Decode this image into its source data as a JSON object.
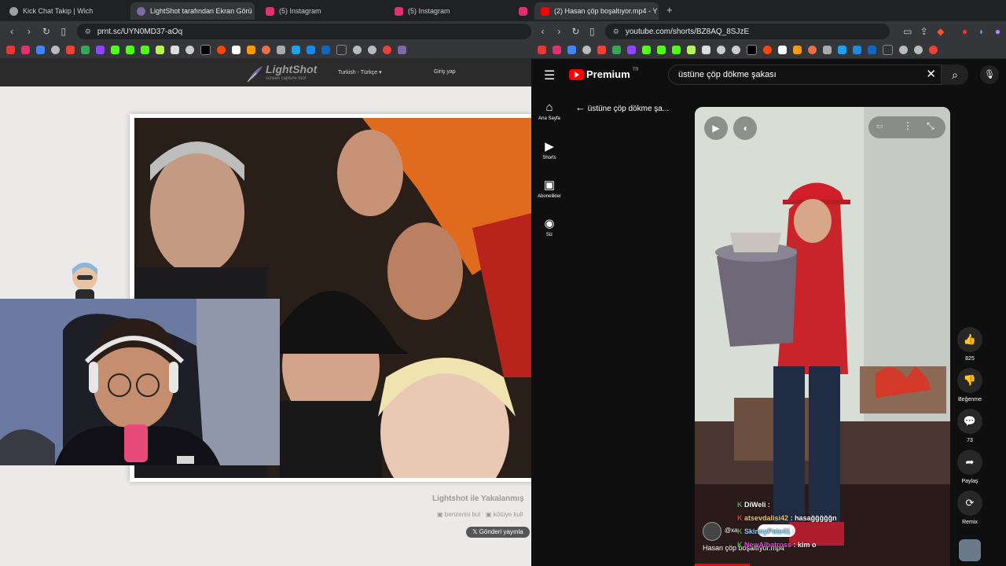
{
  "left_window": {
    "tabs": [
      {
        "title": "Kick Chat Takip | Wich",
        "color": "#9aa0a6"
      },
      {
        "title": "LightShot tarafından Ekran Görü",
        "color": "#7f6aa8"
      },
      {
        "title": "(5) Instagram",
        "color": "#e1306c"
      },
      {
        "title": "(5) Instagram",
        "color": "#e1306c"
      }
    ],
    "tab_close": "✕",
    "url": "prnt.sc/UYN0MD37-aOq"
  },
  "lightshot": {
    "logo": "LightShot",
    "tagline": "screen capture tool",
    "language": "Turkish - Türkçe",
    "login": "Giriş yap",
    "caption": "Lightshot ile Yakalanmış",
    "link_similar": "benzerini bul",
    "link_report": "kötüye kull",
    "tweet": "Gönderi yayınla"
  },
  "right_window": {
    "tab": {
      "title": "(2) Hasan çöp boşaltıyor.mp4 - Y",
      "color": "#ff0000"
    },
    "tab_close": "✕",
    "new_tab": "+",
    "url": "youtube.com/shorts/BZ8AQ_8SJzE"
  },
  "youtube": {
    "logo": "Premium",
    "region": "TR",
    "search_query": "üstüne çöp dökme şakası",
    "back_title": "üstüne çöp dökme şa...",
    "sidebar": [
      {
        "label": "Ana Sayfa",
        "icon": "⌂"
      },
      {
        "label": "Shorts",
        "icon": "▶"
      },
      {
        "label": "Abonelikler",
        "icon": "▣"
      },
      {
        "label": "Siz",
        "icon": "◉"
      }
    ],
    "actions": [
      {
        "label": "825",
        "icon": "👍"
      },
      {
        "label": "Beğenme",
        "icon": "👎"
      },
      {
        "label": "73",
        "icon": "💬"
      },
      {
        "label": "Paylaş",
        "icon": "➦"
      },
      {
        "label": "Remix",
        "icon": "⟳"
      }
    ],
    "channel": "@xa",
    "video_title": "Hasan çöp boşaltıyor.mp4"
  },
  "chat": [
    {
      "user": "DiWeli",
      "msg": "",
      "color": "#ffffff"
    },
    {
      "user": "atsevdalisi42",
      "msg": "hasağğğğğn",
      "color": "#f5c842"
    },
    {
      "user": "",
      "msg": "",
      "color": "#d17cf0"
    },
    {
      "user": "SkinnyPete41",
      "msg": "",
      "color": "#8fd3ff"
    },
    {
      "user": "NewAlbatross",
      "msg": "kim o",
      "color": "#e34ad8"
    }
  ]
}
